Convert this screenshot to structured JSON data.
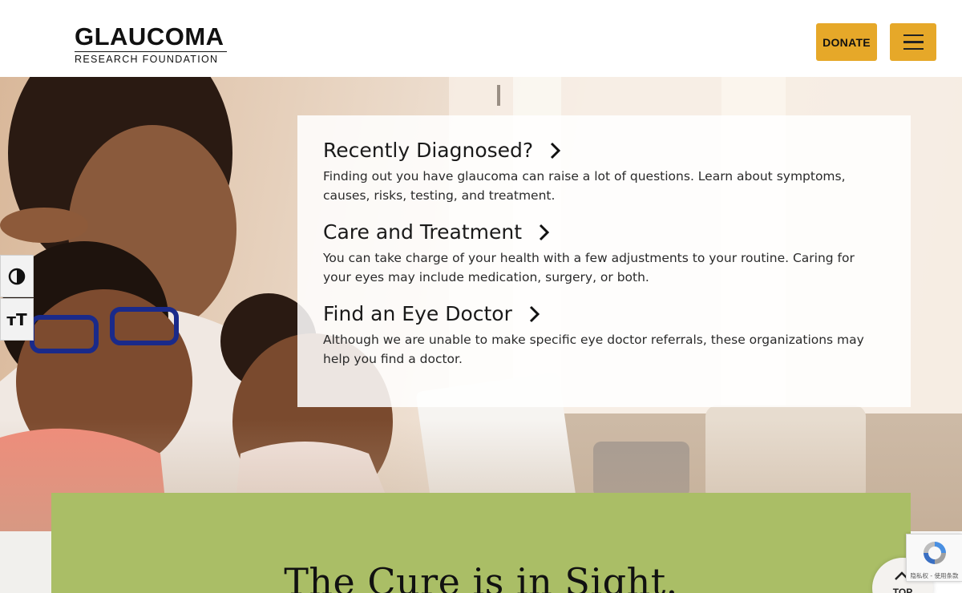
{
  "header": {
    "logo": {
      "main": "GLAUCOMA",
      "sub": "RESEARCH FOUNDATION"
    },
    "donate_label": "DONATE",
    "menu_icon": "hamburger-icon"
  },
  "accessibility": {
    "contrast_icon": "contrast-icon",
    "text_size_icon": "text-size-icon",
    "text_size_glyph": "ᴛT"
  },
  "hero": {
    "items": [
      {
        "title": "Recently Diagnosed?",
        "description": "Finding out you have glaucoma can raise a lot of questions. Learn about symptoms, causes, risks, testing, and treatment."
      },
      {
        "title": "Care and Treatment",
        "description": "You can take charge of your health with a few adjustments to your routine. Caring for your eyes may include medication, surgery, or both."
      },
      {
        "title": "Find an Eye Doctor",
        "description": "Although we are unable to make specific eye doctor referrals, these organizations may help you find a doctor."
      }
    ]
  },
  "mission": {
    "title": "The Cure is in Sight."
  },
  "back_to_top": {
    "label": "TOP"
  },
  "recaptcha": {
    "text": "隐私权 - 使用条款"
  },
  "colors": {
    "accent": "#e6a829",
    "green_section": "#aabe66"
  }
}
